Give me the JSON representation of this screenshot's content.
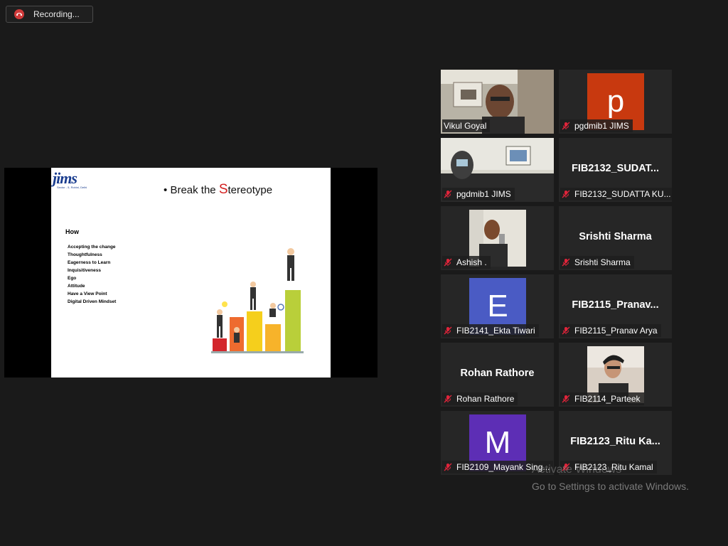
{
  "recording": {
    "label": "Recording..."
  },
  "slide": {
    "logo": "jims",
    "logo_tagline": "Sector - 5, Rohini, Delhi",
    "title_bullet": "•",
    "title_pre": "Break the ",
    "title_cap": "S",
    "title_post": "tereotype",
    "how": "How",
    "items": [
      "Accepting the change",
      "Thoughtfulness",
      "Eagerness to Learn",
      "Inquisitiveness",
      "Ego",
      "Attitude",
      "Have a View Point",
      "Digital Driven Mindset"
    ]
  },
  "participants": [
    {
      "name": "Vikul Goyal",
      "type": "video",
      "active": true
    },
    {
      "name": "pgdmib1 JIMS",
      "type": "avatar",
      "initial": "p",
      "color": "#c8390f"
    },
    {
      "name": "pgdmib1 JIMS",
      "type": "video"
    },
    {
      "name": "FIB2132_SUDATTA KU...",
      "display": "FIB2132_SUDAT...",
      "type": "name"
    },
    {
      "name": "Ashish .",
      "type": "video"
    },
    {
      "name": "Srishti Sharma",
      "display": "Srishti Sharma",
      "type": "name"
    },
    {
      "name": "FIB2141_Ekta Tiwari",
      "type": "avatar",
      "initial": "E",
      "color": "#4a5bc4"
    },
    {
      "name": "FIB2115_Pranav Arya",
      "display": "FIB2115_Pranav...",
      "type": "name"
    },
    {
      "name": "Rohan Rathore",
      "display": "Rohan Rathore",
      "type": "name"
    },
    {
      "name": "FIB2114_Parteek",
      "type": "video"
    },
    {
      "name": "FIB2109_Mayank Sing...",
      "type": "avatar",
      "initial": "M",
      "color": "#5d2eb5"
    },
    {
      "name": "FIB2123_Ritu Kamal",
      "display": "FIB2123_Ritu Ka...",
      "type": "name"
    }
  ],
  "watermark": {
    "line1": "Activate Windows",
    "line2": "Go to Settings to activate Windows."
  },
  "colors": {
    "active_border": "#c8e600",
    "background": "#1a1a1a",
    "tile": "#262626",
    "mic_muted": "#e0243a"
  }
}
